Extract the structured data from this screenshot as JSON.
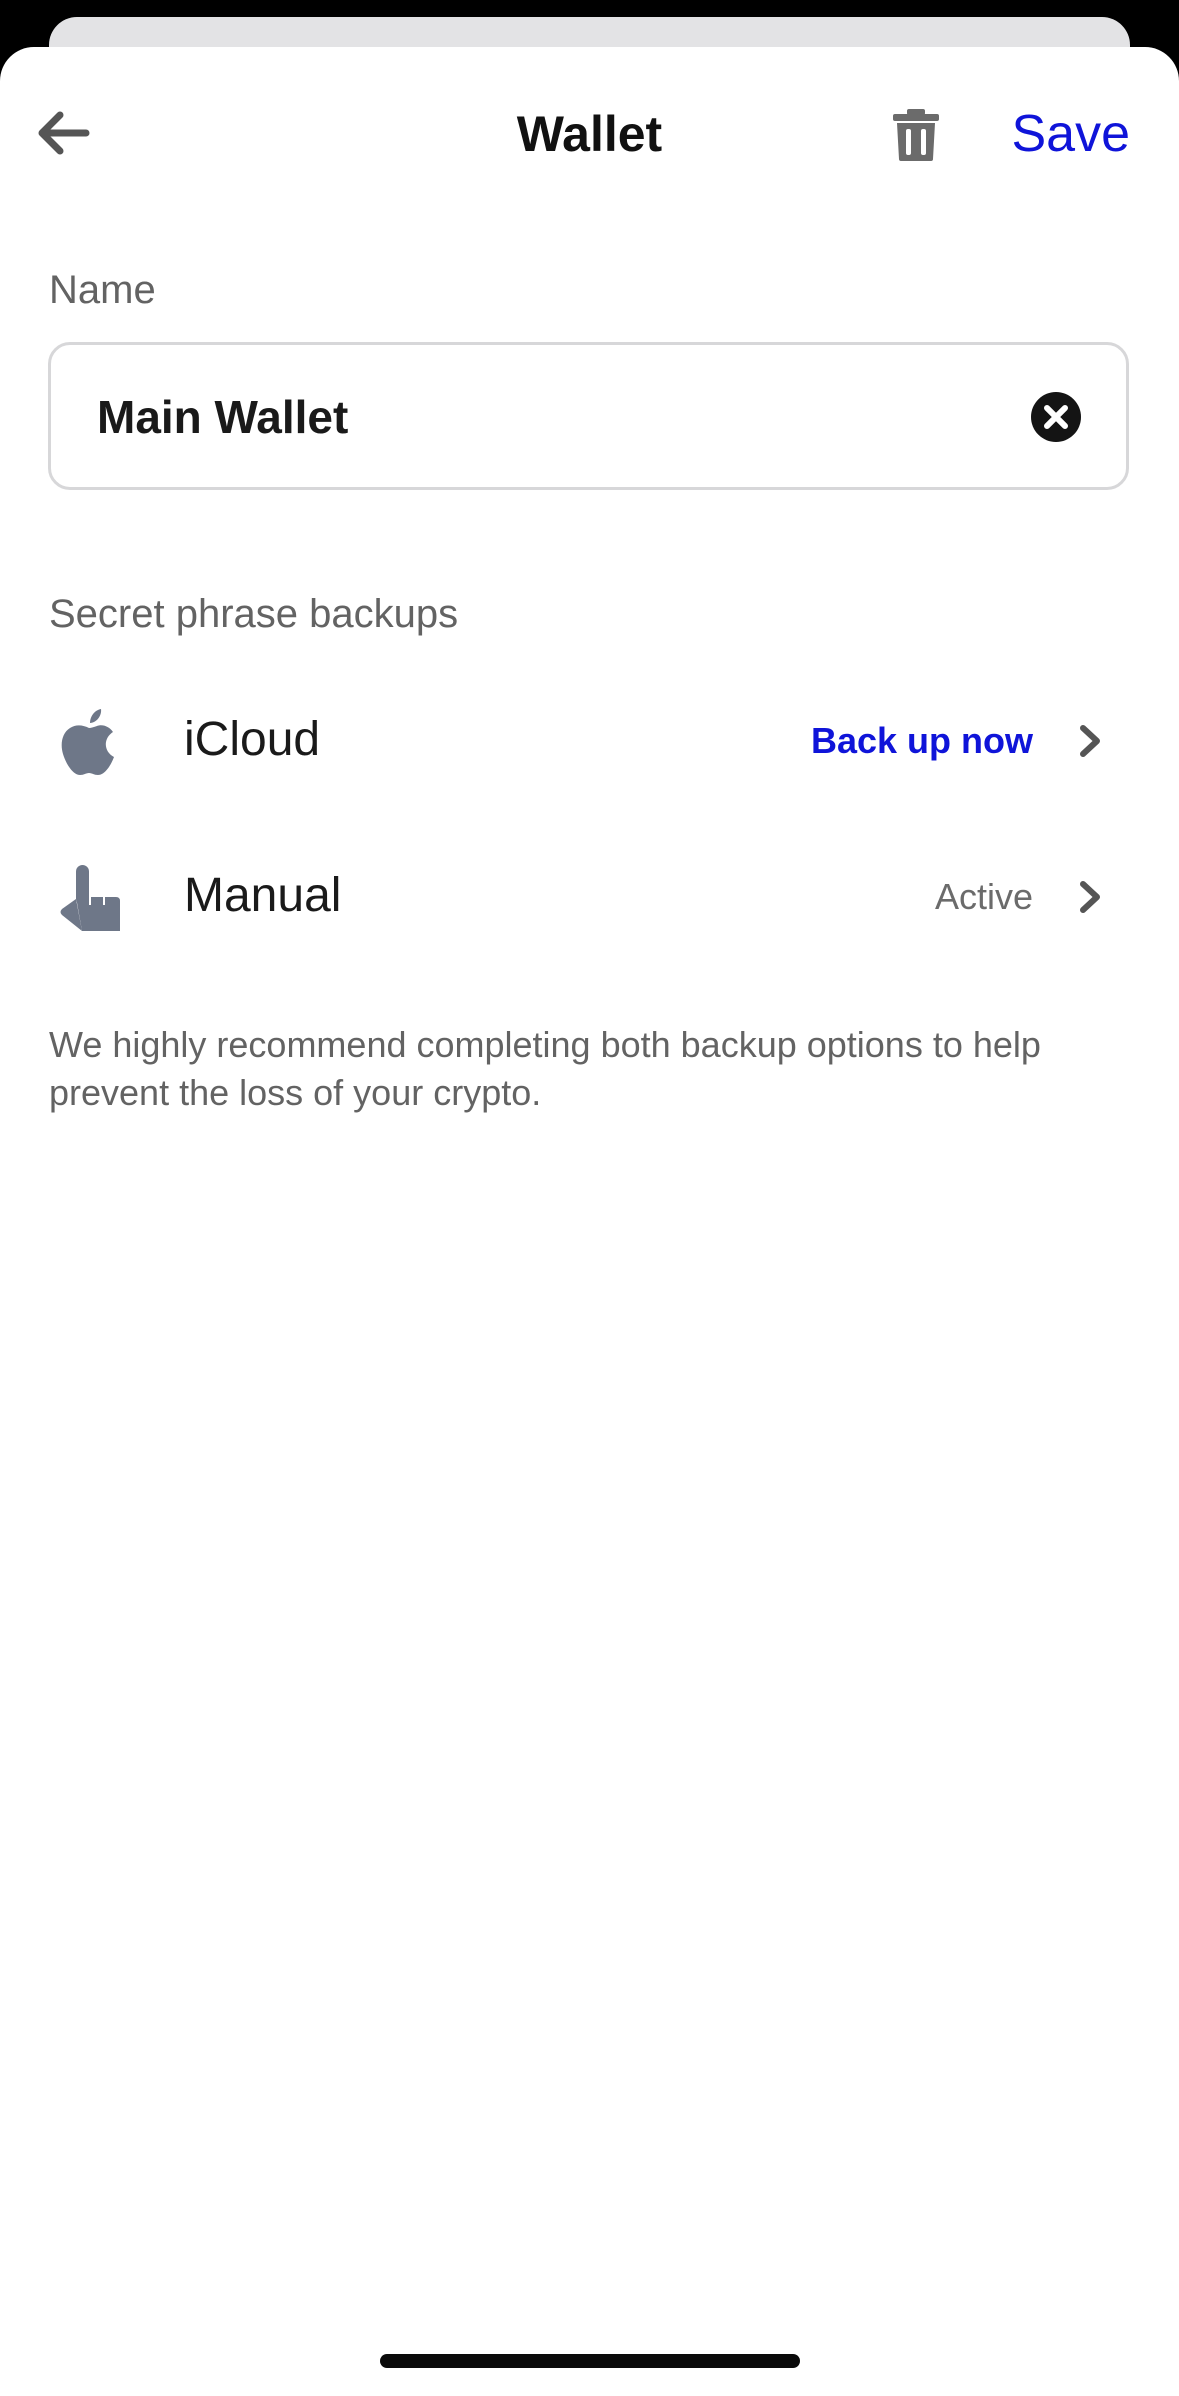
{
  "header": {
    "title": "Wallet",
    "save_label": "Save",
    "back_icon": "arrow-left-icon",
    "delete_icon": "trash-icon"
  },
  "name_section": {
    "label": "Name",
    "value": "Main Wallet",
    "clear_icon": "clear-circle-icon"
  },
  "backups": {
    "section_label": "Secret phrase backups",
    "items": [
      {
        "label": "iCloud",
        "status": "Back up now",
        "status_color": "#0f14d9",
        "icon": "apple-icon"
      },
      {
        "label": "Manual",
        "status": "Active",
        "status_color": "#6b6b6b",
        "icon": "hand-pointer-icon"
      }
    ],
    "note": "We highly recommend completing both backup options to help prevent the loss of your crypto."
  },
  "colors": {
    "accent": "#0f14d9",
    "icon_gray": "#6e7788"
  }
}
